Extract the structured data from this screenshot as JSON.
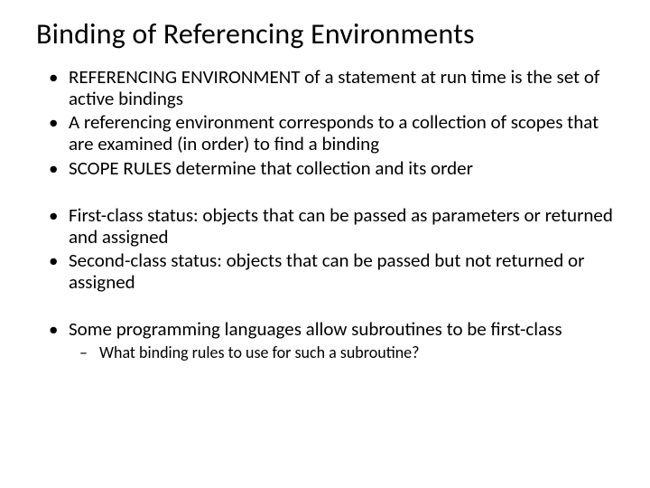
{
  "title": "Binding of Referencing Environments",
  "bullets": {
    "b1": "REFERENCING ENVIRONMENT of a statement at run time is the set of active bindings",
    "b2": "A referencing environment corresponds to a collection of scopes that are examined (in order) to find a binding",
    "b3": "SCOPE RULES determine that collection and its order",
    "b4": "First-class status: objects that can be passed as parameters or returned and assigned",
    "b5": "Second-class status:  objects that can be passed but not returned or assigned",
    "b6": "Some programming languages allow subroutines to be first-class",
    "b6a": "What binding rules to use for such a subroutine?"
  }
}
